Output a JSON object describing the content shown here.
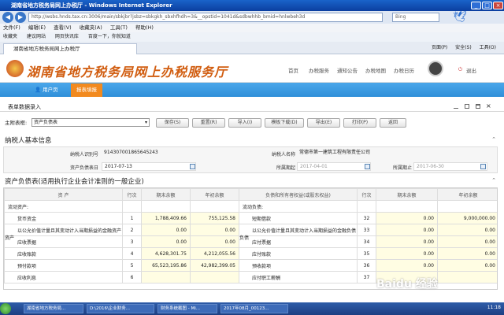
{
  "browser": {
    "title": "湖南省地方税务局网上办税厅 - Windows Internet Explorer",
    "url": "http://wsbs.hnds.tax.cn:3006/main/sbkjbr?jsbz=sbkgkh_sbxhfhdh=3&__opstid=1041d&sdbwhhb_bmid=hnlwbeh3d",
    "search": "Bing",
    "menu": [
      "文件(F)",
      "编辑(E)",
      "查看(V)",
      "收藏夹(A)",
      "工具(T)",
      "帮助(H)"
    ],
    "favorites": [
      "收藏夹",
      "建议网站",
      "网页快讯库",
      "百度一下，你就知道"
    ],
    "tab": "湖南省地方税务局网上办税厅",
    "tools": [
      "页面(P)",
      "安全(S)",
      "工具(O)"
    ]
  },
  "site": {
    "title": "湖南省地方税务局网上办税服务厅",
    "nav": [
      "首页",
      "办税服务",
      "通知公告",
      "办税地图",
      "办税日历"
    ],
    "logout": "退出",
    "home": "用户页",
    "report": "报表填报"
  },
  "window": {
    "title": "表单数据录入"
  },
  "toolbar": {
    "label": "主附表框:",
    "selected": "资产负债表",
    "buttons": [
      "保存(S)",
      "重置(R)",
      "导入(I)",
      "模板下载(D)",
      "导出(E)",
      "打印(P)",
      "返回"
    ]
  },
  "basic": {
    "title": "纳税人基本信息",
    "labels": [
      "纳税人识别号",
      "纳税人名称",
      "资产负债表日",
      "所属期起",
      "所属期止"
    ],
    "taxid": "914307001865645243",
    "name": "常德市第一建筑工程有限责任公司",
    "date": "2017-07-13",
    "start": "2017-04-01",
    "end": "2017-06-30"
  },
  "bs": {
    "title": "资产负债表(适用执行企业会计准则的一般企业)",
    "headers": [
      "资 产",
      "行次",
      "期末余额",
      "年初余额",
      "负债和所有者权益(或股东权益)",
      "行次",
      "期末余额",
      "年初余额"
    ],
    "left_cat": "资产",
    "right_cat": "负债",
    "rows": [
      [
        "流动资产:",
        "",
        "",
        "",
        "流动负债:",
        "",
        "",
        ""
      ],
      [
        "货币资金",
        "1",
        "1,788,409.66",
        "755,125.58",
        "短期借款",
        "32",
        "0.00",
        "9,000,000.00"
      ],
      [
        "以公允价值计量且其变动计入当期损益的金融资产",
        "2",
        "0.00",
        "0.00",
        "以公允价值计量且其变动计入当期损益的金融负债",
        "33",
        "0.00",
        "0.00"
      ],
      [
        "应收票据",
        "3",
        "0.00",
        "0.00",
        "应付票据",
        "34",
        "0.00",
        "0.00"
      ],
      [
        "应收账款",
        "4",
        "4,628,301.75",
        "4,212,055.56",
        "应付账款",
        "35",
        "0.00",
        "0.00"
      ],
      [
        "预付款项",
        "5",
        "65,523,195.86",
        "42,982,399.05",
        "预收款项",
        "36",
        "0.00",
        "0.00"
      ],
      [
        "应收利息",
        "6",
        "",
        "",
        "应付职工薪酬",
        "37",
        "",
        ""
      ]
    ]
  },
  "taskbar": {
    "tasks": [
      "湖南省地方税务局...",
      "D:\\2016\\企业财务...",
      "财务系统截图 - Mi...",
      "2017年08月_00123..."
    ],
    "clock": "11:18"
  },
  "watermark": "Baidu 经验"
}
